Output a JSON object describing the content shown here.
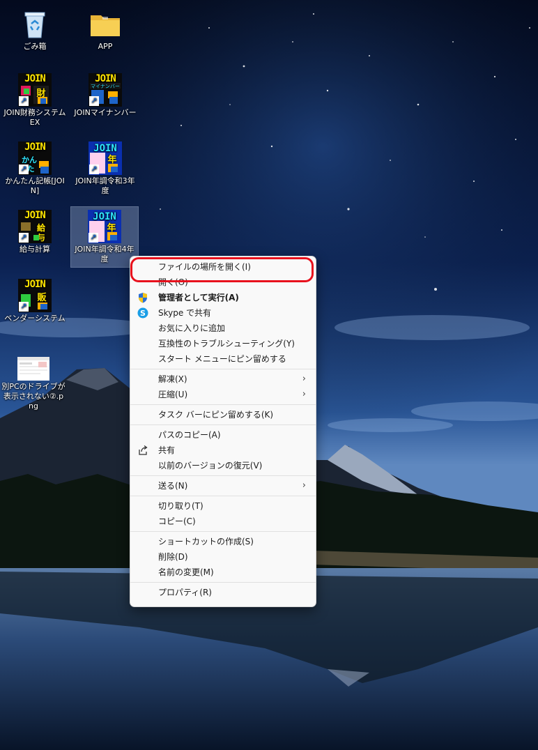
{
  "desktop": {
    "icons": [
      {
        "label": "ごみ箱"
      },
      {
        "label": "APP"
      },
      {
        "label": "JOIN財務システムEX",
        "badge": "財務"
      },
      {
        "label": "JOINマイナンバー",
        "badge": "マイナンバー"
      },
      {
        "label": "かんたん記帳[JOIN]",
        "badge": "かんたん"
      },
      {
        "label": "JOIN年調令和3年度",
        "badge": "年"
      },
      {
        "label": "給与計算",
        "badge": "給与"
      },
      {
        "label": "JOIN年調令和4年度",
        "badge": "年"
      },
      {
        "label": "ベンダーシステム",
        "badge": "販"
      },
      {
        "label": "別PCのドライブが表示されない②.png"
      }
    ],
    "join_text": "JOIN"
  },
  "context_menu": {
    "groups": [
      [
        {
          "label": "ファイルの場所を開く(I)"
        },
        {
          "label": "開く(O)"
        },
        {
          "label": "管理者として実行(A)",
          "icon": "uac-shield-icon",
          "bold": true
        },
        {
          "label": "Skype で共有",
          "icon": "skype-icon"
        },
        {
          "label": "お気に入りに追加"
        },
        {
          "label": "互換性のトラブルシューティング(Y)"
        },
        {
          "label": "スタート メニューにピン留めする"
        }
      ],
      [
        {
          "label": "解凍(X)",
          "submenu": true
        },
        {
          "label": "圧縮(U)",
          "submenu": true
        }
      ],
      [
        {
          "label": "タスク バーにピン留めする(K)"
        }
      ],
      [
        {
          "label": "パスのコピー(A)"
        },
        {
          "label": "共有",
          "icon": "share-icon"
        },
        {
          "label": "以前のバージョンの復元(V)"
        }
      ],
      [
        {
          "label": "送る(N)",
          "submenu": true
        }
      ],
      [
        {
          "label": "切り取り(T)"
        },
        {
          "label": "コピー(C)"
        }
      ],
      [
        {
          "label": "ショートカットの作成(S)"
        },
        {
          "label": "削除(D)"
        },
        {
          "label": "名前の変更(M)"
        }
      ],
      [
        {
          "label": "プロパティ(R)"
        }
      ]
    ],
    "submenu_glyph": "›"
  },
  "colors": {
    "highlight_ring": "#e8111d",
    "menu_bg": "#f9f9f9",
    "join_yellow": "#ffe400",
    "join_cyan": "#2fe6ff"
  }
}
